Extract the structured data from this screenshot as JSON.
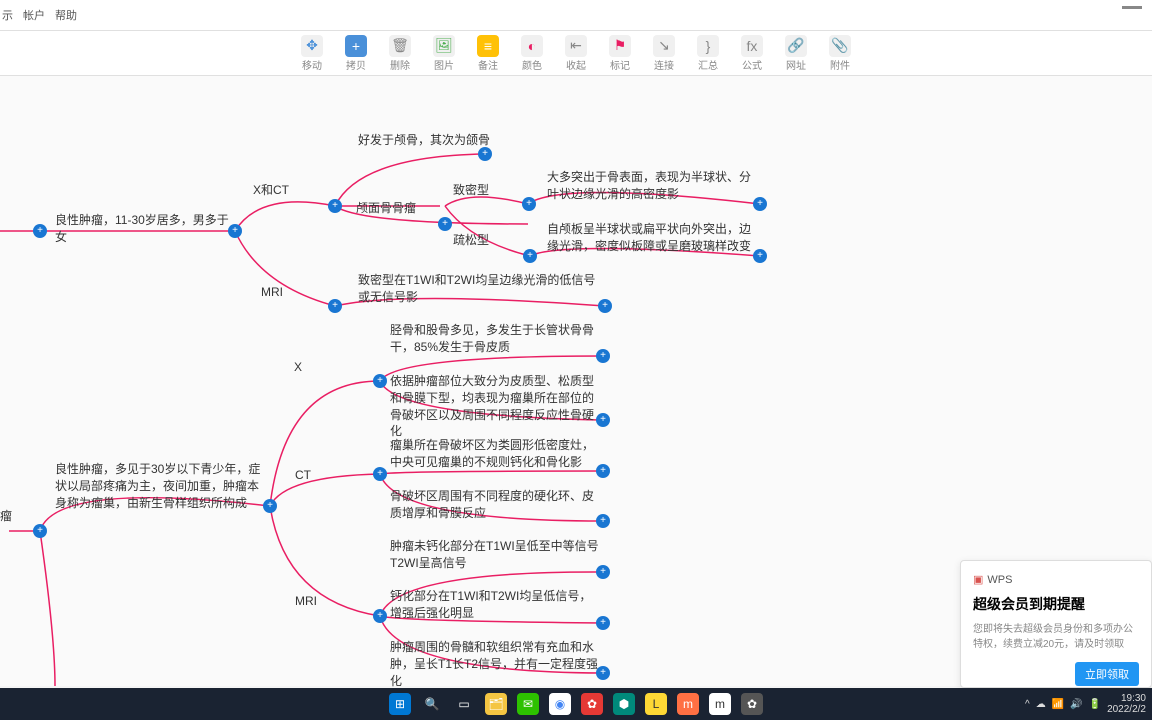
{
  "menu": {
    "items": [
      "示",
      "帐户",
      "帮助"
    ]
  },
  "toolbar": {
    "items": [
      {
        "label": "移动",
        "glyph": "✥",
        "bg": "#f0f0f0",
        "fg": "#4a90d9"
      },
      {
        "label": "拷贝",
        "glyph": "+",
        "bg": "#4a90d9",
        "fg": "#fff"
      },
      {
        "label": "删除",
        "glyph": "🗑",
        "bg": "#f0f0f0",
        "fg": "#888"
      },
      {
        "label": "图片",
        "glyph": "🖼",
        "bg": "#f0f0f0",
        "fg": "#4caf50"
      },
      {
        "label": "备注",
        "glyph": "≡",
        "bg": "#ffc107",
        "fg": "#fff"
      },
      {
        "label": "颜色",
        "glyph": "◐",
        "bg": "#f0f0f0",
        "fg": "#e91e63"
      },
      {
        "label": "收起",
        "glyph": "⇤",
        "bg": "#f0f0f0",
        "fg": "#888"
      },
      {
        "label": "标记",
        "glyph": "⚑",
        "bg": "#f0f0f0",
        "fg": "#e91e63"
      },
      {
        "label": "连接",
        "glyph": "↘",
        "bg": "#f0f0f0",
        "fg": "#888"
      },
      {
        "label": "汇总",
        "glyph": "}",
        "bg": "#f0f0f0",
        "fg": "#888"
      },
      {
        "label": "公式",
        "glyph": "fx",
        "bg": "#f0f0f0",
        "fg": "#888"
      },
      {
        "label": "网址",
        "glyph": "🔗",
        "bg": "#f0f0f0",
        "fg": "#888"
      },
      {
        "label": "附件",
        "glyph": "📎",
        "bg": "#f0f0f0",
        "fg": "#888"
      }
    ]
  },
  "nodes": {
    "n1": "良性肿瘤，11-30岁居多，男多于女",
    "n2": "X和CT",
    "n3": "MRI",
    "n4": "好发于颅骨，其次为颌骨",
    "n5": "颅面骨骨瘤",
    "n6": "致密型",
    "n7": "疏松型",
    "n8": "大多突出于骨表面，表现为半球状、分叶状边缘光滑的高密度影",
    "n9": "自颅板呈半球状或扁平状向外突出，边缘光滑，密度似板障或呈磨玻璃样改变",
    "n10": "致密型在T1WI和T2WI均呈边缘光滑的低信号或无信号影",
    "n11": "瘤",
    "n12": "良性肿瘤，多见于30岁以下青少年，症状以局部疼痛为主，夜间加重，肿瘤本身称为瘤巢，由新生骨样组织所构成",
    "n13": "X",
    "n14": "CT",
    "n15": "MRI",
    "n16": "胫骨和股骨多见，多发生于长管状骨骨干，85%发生于骨皮质",
    "n17": "依据肿瘤部位大致分为皮质型、松质型和骨膜下型，均表现为瘤巢所在部位的骨破坏区以及周围不同程度反应性骨硬化",
    "n18": "瘤巢所在骨破坏区为类圆形低密度灶，中央可见瘤巢的不规则钙化和骨化影",
    "n19": "骨破坏区周围有不同程度的硬化环、皮质增厚和骨膜反应",
    "n20": "肿瘤未钙化部分在T1WI呈低至中等信号T2WI呈高信号",
    "n21": "钙化部分在T1WI和T2WI均呈低信号，增强后强化明显",
    "n22": "肿瘤周围的骨髓和软组织常有充血和水肿，呈长T1长T2信号，并有一定程度强化"
  },
  "wps": {
    "brand": "WPS",
    "title": "超级会员到期提醒",
    "desc": "您即将失去超级会员身份和多项办公特权，续费立减20元，请及时领取",
    "btn": "立即领取"
  },
  "taskbar": {
    "time": "19:30",
    "date": "2022/2/2"
  }
}
